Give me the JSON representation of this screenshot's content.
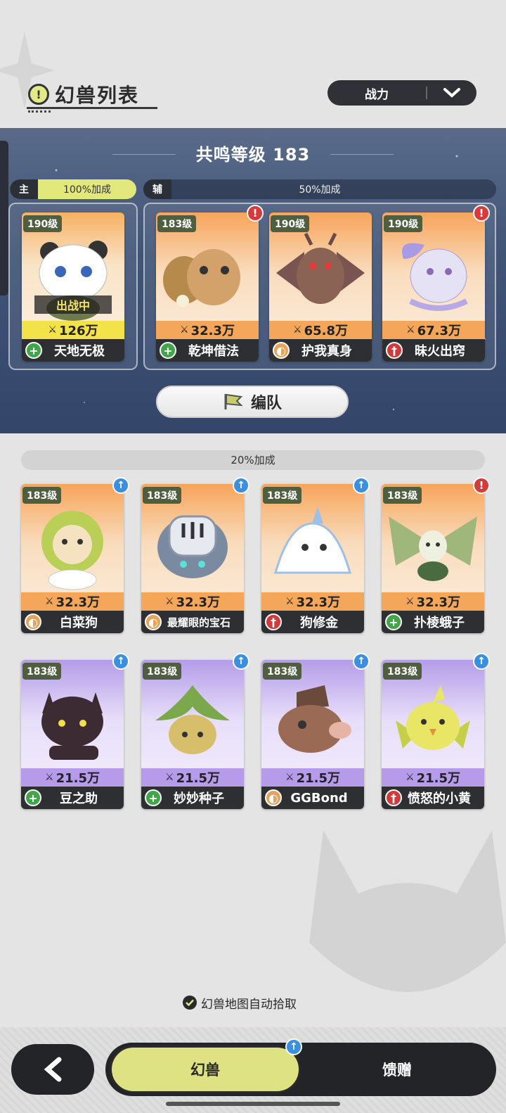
{
  "header": {
    "title": "幻兽列表",
    "sort_label": "战力"
  },
  "resonance": {
    "title": "共鸣等级 183",
    "main_tag": "主",
    "main_bonus": "100%加成",
    "sub_tag": "辅",
    "sub_bonus": "50%加成",
    "main_card": {
      "level": "190级",
      "status": "出战中",
      "power": "126万",
      "name": "天地无极",
      "type": "heal"
    },
    "sub_cards": [
      {
        "level": "183级",
        "power": "32.3万",
        "name": "乾坤借法",
        "type": "heal",
        "alert": "!"
      },
      {
        "level": "190级",
        "power": "65.8万",
        "name": "护我真身",
        "type": "def"
      },
      {
        "level": "190级",
        "power": "67.3万",
        "name": "昧火出窍",
        "type": "atk",
        "alert": "!"
      }
    ],
    "team_button": "编队"
  },
  "reserve": {
    "bonus": "20%加成",
    "row1": [
      {
        "level": "183级",
        "power": "32.3万",
        "name": "白菜狗",
        "type": "def",
        "badge": "up"
      },
      {
        "level": "183级",
        "power": "32.3万",
        "name": "最耀眼的宝石",
        "type": "def",
        "badge": "up"
      },
      {
        "level": "183级",
        "power": "32.3万",
        "name": "狗修金",
        "type": "atk",
        "badge": "up"
      },
      {
        "level": "183级",
        "power": "32.3万",
        "name": "扑棱蛾子",
        "type": "heal",
        "badge": "alert"
      }
    ],
    "row2": [
      {
        "level": "183级",
        "power": "21.5万",
        "name": "豆之助",
        "type": "heal",
        "badge": "up"
      },
      {
        "level": "183级",
        "power": "21.5万",
        "name": "妙妙种子",
        "type": "heal",
        "badge": "up"
      },
      {
        "level": "183级",
        "power": "21.5万",
        "name": "GGBond",
        "type": "def",
        "badge": "up"
      },
      {
        "level": "183级",
        "power": "21.5万",
        "name": "愤怒的小黄",
        "type": "atk",
        "badge": "up"
      }
    ]
  },
  "auto_pick_label": "幻兽地图自动拾取",
  "tabs": {
    "active": "幻兽",
    "inactive": "馈赠"
  },
  "colors": {
    "accent_yellow": "#dfe283",
    "power_gold": "#f3e24a",
    "power_orange": "#f4a65a",
    "power_purple": "#b69bea",
    "heal": "#41a64a",
    "def": "#e6a45a",
    "atk": "#cf3b3b",
    "alert": "#d63a3a",
    "up": "#3b8fe0"
  },
  "icons": [
    "warning-icon",
    "chevron-down-icon",
    "flag-icon",
    "power-icon",
    "heal-type-icon",
    "defense-type-icon",
    "attack-type-icon",
    "alert-icon",
    "upgrade-arrow-icon",
    "checkmark-icon",
    "back-arrow-icon"
  ]
}
